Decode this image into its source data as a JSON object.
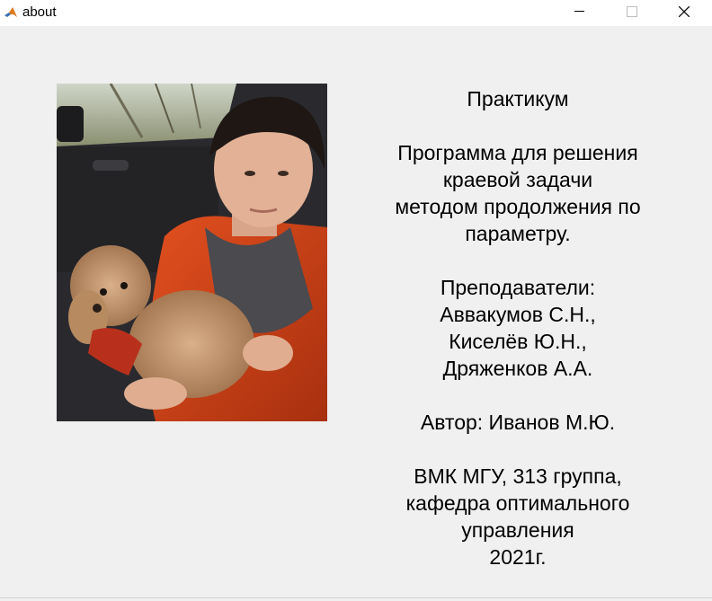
{
  "window": {
    "title": "about",
    "app_icon": "matlab-icon",
    "controls": {
      "minimize_icon": "minimize-icon",
      "maximize_icon": "maximize-icon",
      "close_icon": "close-icon"
    }
  },
  "photo": {
    "subject": "author-photo"
  },
  "info": {
    "line1": "Практикум",
    "line2": "",
    "line3": "Программа для решения",
    "line4": "краевой задачи",
    "line5": "методом продолжения по",
    "line6": "параметру.",
    "line7": "",
    "line8": "Преподаватели:",
    "line9": "Аввакумов С.Н.,",
    "line10": "Киселёв Ю.Н.,",
    "line11": "Дряженков А.А.",
    "line12": "",
    "line13": "Автор: Иванов М.Ю.",
    "line14": "",
    "line15": "ВМК МГУ, 313 группа,",
    "line16": "кафедра оптимального",
    "line17": "управления",
    "line18": "2021г."
  }
}
